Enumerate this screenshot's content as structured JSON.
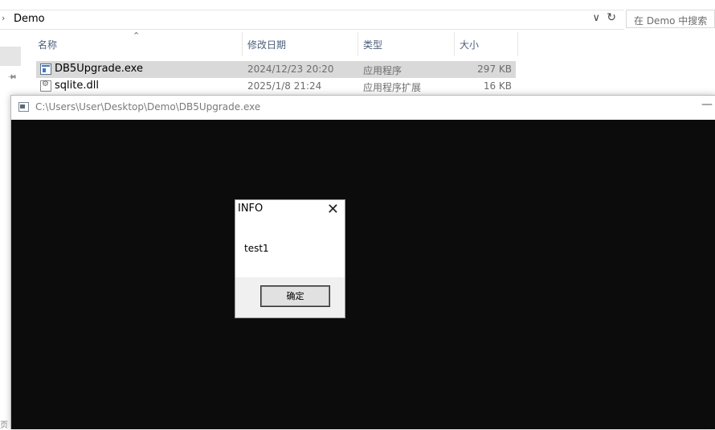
{
  "explorer": {
    "address_path": "Demo",
    "search_placeholder": "在 Demo 中搜索",
    "columns": {
      "name": "名称",
      "date": "修改日期",
      "type": "类型",
      "size": "大小"
    },
    "files": [
      {
        "name": "DB5Upgrade.exe",
        "date": "2024/12/23 20:20",
        "type": "应用程序",
        "size": "297 KB",
        "icon": "exe-icon",
        "selected": true
      },
      {
        "name": "sqlite.dll",
        "date": "2025/1/8 21:24",
        "type": "应用程序扩展",
        "size": "16 KB",
        "icon": "dll-icon",
        "selected": false
      }
    ],
    "edge_fragment": "页"
  },
  "console": {
    "title": "C:\\Users\\User\\Desktop\\Demo\\DB5Upgrade.exe",
    "background": "#0c0c0c"
  },
  "msgbox": {
    "title": "INFO",
    "message": "test1",
    "ok_label": "确定"
  }
}
